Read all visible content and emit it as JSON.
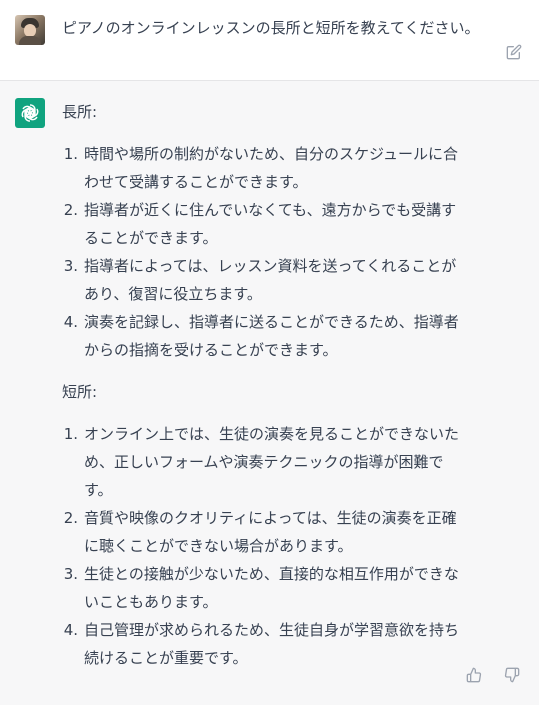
{
  "question": {
    "text": "ピアノのオンラインレッスンの長所と短所を教えてください。"
  },
  "answer": {
    "pros_heading": "長所:",
    "pros": [
      "時間や場所の制約がないため、自分のスケジュールに合わせて受講することができます。",
      "指導者が近くに住んでいなくても、遠方からでも受講することができます。",
      "指導者によっては、レッスン資料を送ってくれることがあり、復習に役立ちます。",
      "演奏を記録し、指導者に送ることができるため、指導者からの指摘を受けることができます。"
    ],
    "cons_heading": "短所:",
    "cons": [
      "オンライン上では、生徒の演奏を見ることができないため、正しいフォームや演奏テクニックの指導が困難です。",
      "音質や映像のクオリティによっては、生徒の演奏を正確に聴くことができない場合があります。",
      "生徒との接触が少ないため、直接的な相互作用ができないこともあります。",
      "自己管理が求められるため、生徒自身が学習意欲を持ち続けることが重要です。"
    ]
  },
  "numbers": [
    "1.",
    "2.",
    "3.",
    "4."
  ],
  "icons": {
    "user_avatar": "user-avatar-photo",
    "assistant_avatar": "openai-logo-icon",
    "edit": "edit-icon",
    "like": "thumbs-up-icon",
    "dislike": "thumbs-down-icon"
  },
  "colors": {
    "assistant_accent": "#10a37f",
    "text": "#374151",
    "assistant_bg": "#f7f7f8"
  }
}
